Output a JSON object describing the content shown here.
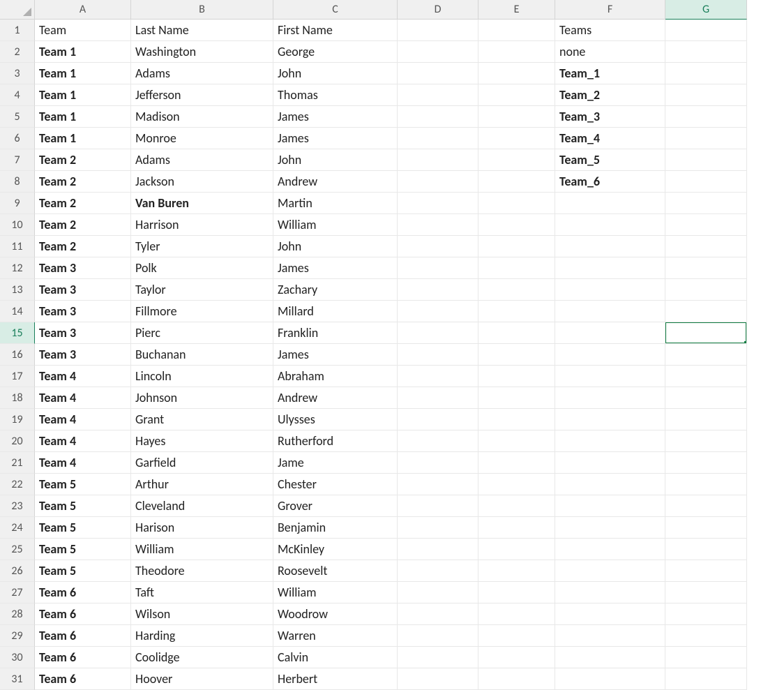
{
  "columns": [
    "A",
    "B",
    "C",
    "D",
    "E",
    "F",
    "G"
  ],
  "activeColumn": "G",
  "activeRow": 15,
  "rows": [
    {
      "r": 1,
      "a": "Team",
      "aBold": false,
      "b": "Last Name",
      "bBold": false,
      "c": "First Name",
      "f": "Teams",
      "fBold": false
    },
    {
      "r": 2,
      "a": "Team 1",
      "aBold": true,
      "b": "Washington",
      "c": "George",
      "f": "none",
      "fBold": false
    },
    {
      "r": 3,
      "a": "Team 1",
      "aBold": true,
      "b": "Adams",
      "c": "John",
      "f": "Team_1",
      "fBold": true
    },
    {
      "r": 4,
      "a": "Team 1",
      "aBold": true,
      "b": "Jefferson",
      "c": "Thomas",
      "f": "Team_2",
      "fBold": true
    },
    {
      "r": 5,
      "a": "Team 1",
      "aBold": true,
      "b": "Madison",
      "c": "James",
      "f": "Team_3",
      "fBold": true
    },
    {
      "r": 6,
      "a": "Team 1",
      "aBold": true,
      "b": "Monroe",
      "c": "James",
      "f": "Team_4",
      "fBold": true
    },
    {
      "r": 7,
      "a": "Team 2",
      "aBold": true,
      "b": "Adams",
      "c": "John",
      "f": "Team_5",
      "fBold": true
    },
    {
      "r": 8,
      "a": "Team 2",
      "aBold": true,
      "b": "Jackson",
      "c": "Andrew",
      "f": "Team_6",
      "fBold": true
    },
    {
      "r": 9,
      "a": "Team 2",
      "aBold": true,
      "b": "Van Buren",
      "bBold": true,
      "c": "Martin",
      "f": ""
    },
    {
      "r": 10,
      "a": "Team 2",
      "aBold": true,
      "b": "Harrison",
      "c": "William",
      "f": ""
    },
    {
      "r": 11,
      "a": "Team 2",
      "aBold": true,
      "b": "Tyler",
      "c": "John",
      "f": ""
    },
    {
      "r": 12,
      "a": "Team 3",
      "aBold": true,
      "b": "Polk",
      "c": "James",
      "f": ""
    },
    {
      "r": 13,
      "a": "Team 3",
      "aBold": true,
      "b": "Taylor",
      "c": "Zachary",
      "f": ""
    },
    {
      "r": 14,
      "a": "Team 3",
      "aBold": true,
      "b": "Fillmore",
      "c": "Millard",
      "f": ""
    },
    {
      "r": 15,
      "a": "Team 3",
      "aBold": true,
      "b": "Pierc",
      "c": "Franklin",
      "f": ""
    },
    {
      "r": 16,
      "a": "Team 3",
      "aBold": true,
      "b": "Buchanan",
      "c": "James",
      "f": ""
    },
    {
      "r": 17,
      "a": "Team 4",
      "aBold": true,
      "b": "Lincoln",
      "c": "Abraham",
      "f": ""
    },
    {
      "r": 18,
      "a": "Team 4",
      "aBold": true,
      "b": "Johnson",
      "c": "Andrew",
      "f": ""
    },
    {
      "r": 19,
      "a": "Team 4",
      "aBold": true,
      "b": "Grant",
      "c": "Ulysses",
      "f": ""
    },
    {
      "r": 20,
      "a": "Team 4",
      "aBold": true,
      "b": "Hayes",
      "c": "Rutherford",
      "f": ""
    },
    {
      "r": 21,
      "a": "Team 4",
      "aBold": true,
      "b": "Garfield",
      "c": "Jame",
      "f": ""
    },
    {
      "r": 22,
      "a": "Team 5",
      "aBold": true,
      "b": "Arthur",
      "c": "Chester",
      "f": ""
    },
    {
      "r": 23,
      "a": "Team 5",
      "aBold": true,
      "b": "Cleveland",
      "c": "Grover",
      "f": ""
    },
    {
      "r": 24,
      "a": "Team 5",
      "aBold": true,
      "b": "Harison",
      "c": "Benjamin",
      "f": ""
    },
    {
      "r": 25,
      "a": "Team 5",
      "aBold": true,
      "b": "William",
      "c": "McKinley",
      "f": ""
    },
    {
      "r": 26,
      "a": "Team 5",
      "aBold": true,
      "b": "Theodore",
      "c": "Roosevelt",
      "f": ""
    },
    {
      "r": 27,
      "a": "Team 6",
      "aBold": true,
      "b": "Taft",
      "c": "William",
      "f": ""
    },
    {
      "r": 28,
      "a": "Team 6",
      "aBold": true,
      "b": "Wilson",
      "c": "Woodrow",
      "f": ""
    },
    {
      "r": 29,
      "a": "Team 6",
      "aBold": true,
      "b": "Harding",
      "c": "Warren",
      "f": ""
    },
    {
      "r": 30,
      "a": "Team 6",
      "aBold": true,
      "b": "Coolidge",
      "c": "Calvin",
      "f": ""
    },
    {
      "r": 31,
      "a": "Team 6",
      "aBold": true,
      "b": "Hoover",
      "c": "Herbert",
      "f": ""
    }
  ],
  "selectedCell": "G15"
}
